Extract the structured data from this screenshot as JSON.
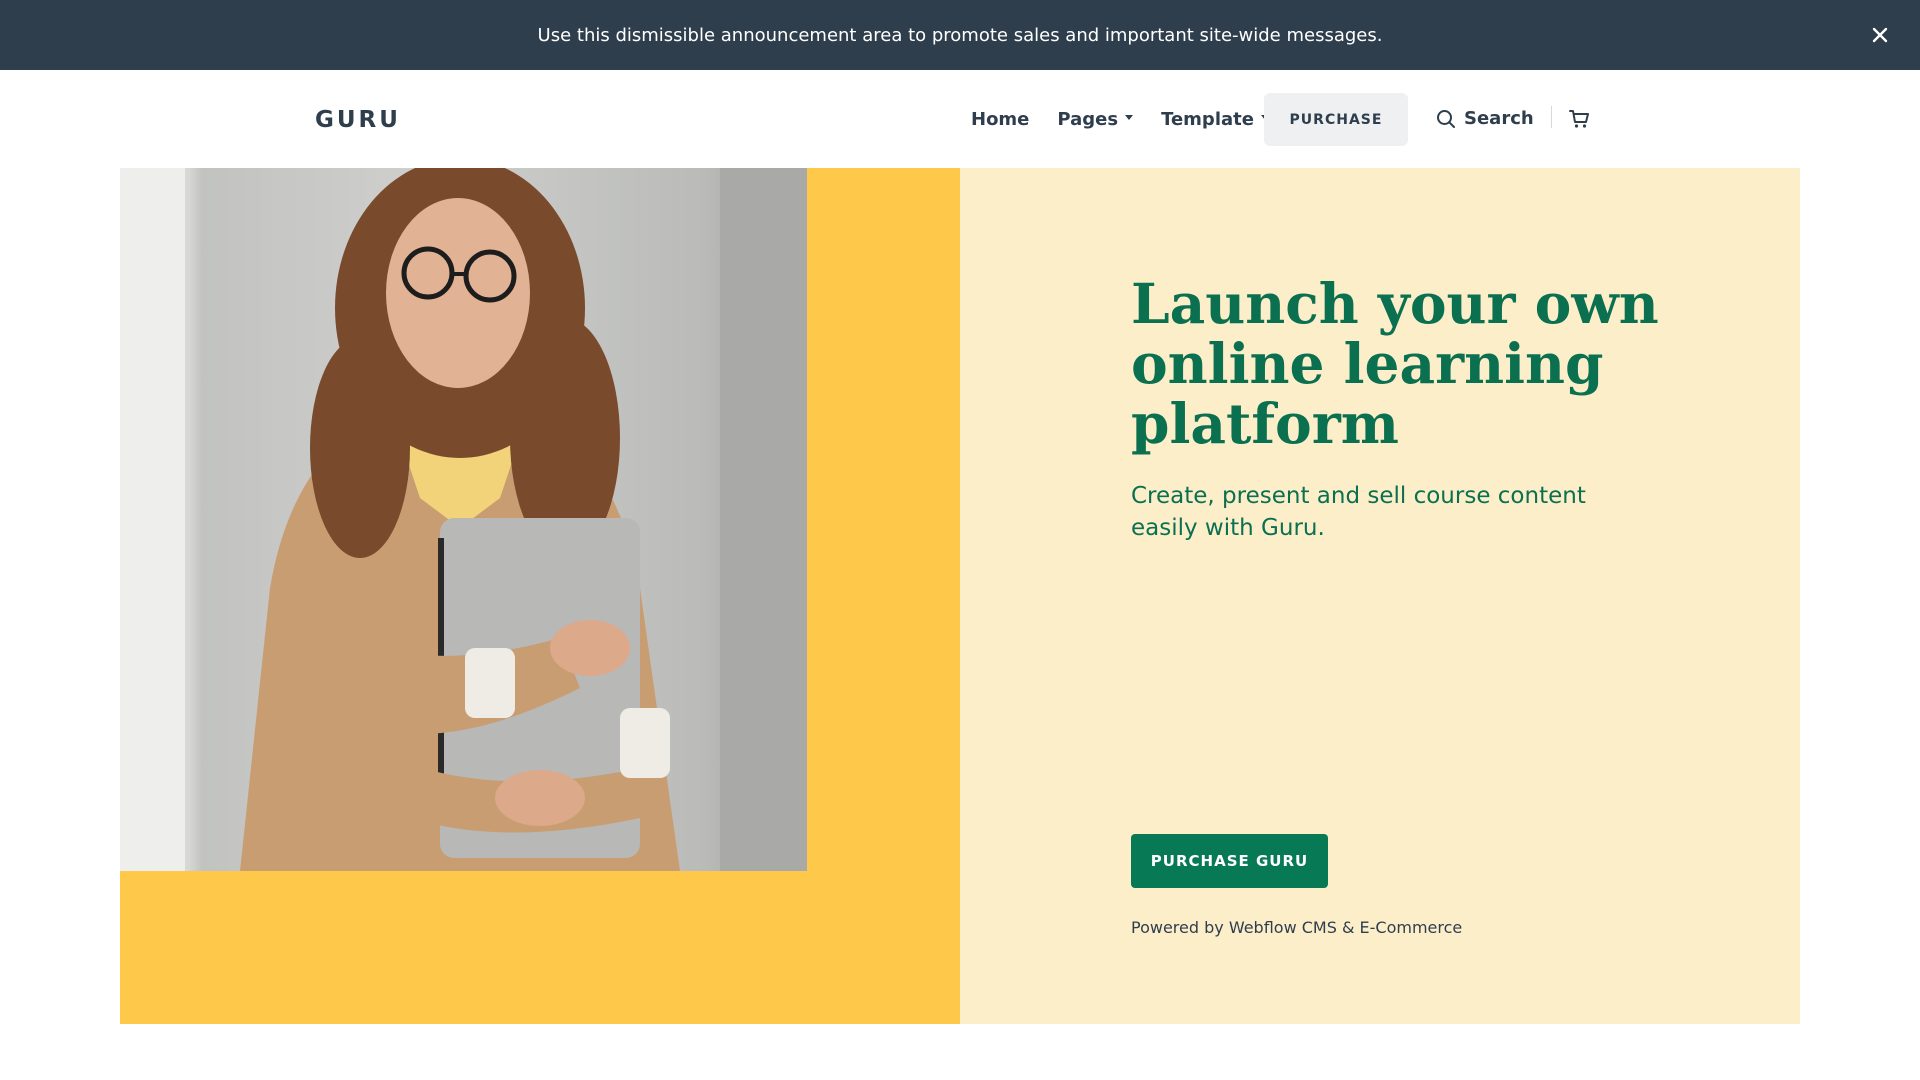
{
  "announcement": {
    "text": "Use this dismissible announcement area to promote sales and important site-wide messages.",
    "close_icon": "close-icon"
  },
  "header": {
    "logo": "GURU",
    "nav": [
      {
        "label": "Home",
        "dropdown": false
      },
      {
        "label": "Pages",
        "dropdown": true
      },
      {
        "label": "Template",
        "dropdown": true
      }
    ],
    "purchase_label": "PURCHASE",
    "search_label": "Search",
    "search_icon": "search-icon",
    "cart_icon": "cart-icon"
  },
  "hero": {
    "title": "Launch your own online learning platform",
    "subtitle": "Create, present and sell course content easily with Guru.",
    "cta_label": "PURCHASE GURU",
    "powered_by": "Powered by Webflow CMS & E-Commerce",
    "image_icon": "woman-holding-laptop-photo"
  },
  "colors": {
    "announcement_bg": "#2f3e4d",
    "brand_green": "#0b7050",
    "accent_yellow": "#fec84b",
    "hero_cream": "#fdeeca"
  }
}
